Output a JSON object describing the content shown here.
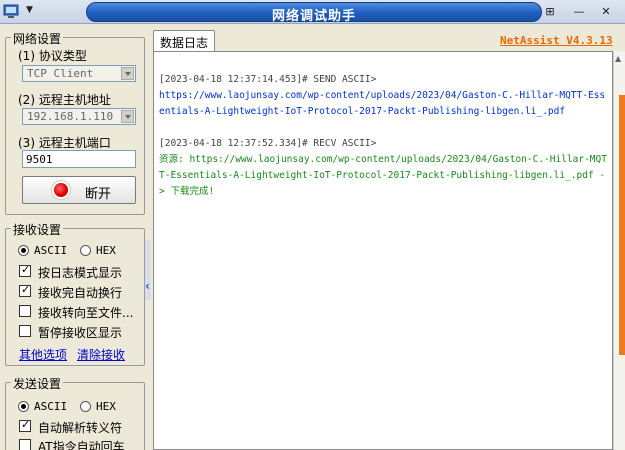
{
  "window": {
    "title": "网络调试助手",
    "controls": {
      "pin": "⊞",
      "minimize": "—",
      "close": "✕"
    }
  },
  "network": {
    "title": "网络设置",
    "protocol_label": "(1) 协议类型",
    "protocol_value": "TCP Client",
    "host_label": "(2) 远程主机地址",
    "host_value": "192.168.1.110",
    "port_label": "(3) 远程主机端口",
    "port_value": "9501",
    "open_button": "断开"
  },
  "receive": {
    "title": "接收设置",
    "ascii": "ASCII",
    "hex": "HEX",
    "options": [
      {
        "label": "按日志模式显示",
        "checked": true
      },
      {
        "label": "接收完自动换行",
        "checked": true
      },
      {
        "label": "接收转向至文件...",
        "checked": false
      },
      {
        "label": "暂停接收区显示",
        "checked": false
      }
    ],
    "more_link": "其他选项",
    "clear_link": "清除接收"
  },
  "send": {
    "title": "发送设置",
    "ascii": "ASCII",
    "hex": "HEX",
    "options": [
      {
        "label": "自动解析转义符",
        "checked": true
      },
      {
        "label": "AT指令自动回车",
        "checked": false
      }
    ]
  },
  "log": {
    "tab": "数据日志",
    "version": "NetAssist V4.3.13",
    "entries": [
      {
        "header": "[2023-04-18 12:37:14.453]# SEND ASCII>",
        "body": "https://www.laojunsay.com/wp-content/uploads/2023/04/Gaston-C.-Hillar-MQTT-Essentials-A-Lightweight-IoT-Protocol-2017-Packt-Publishing-libgen.li_.pdf"
      },
      {
        "header": "[2023-04-18 12:37:52.334]# RECV ASCII>",
        "body": "资源: https://www.laojunsay.com/wp-content/uploads/2023/04/Gaston-C.-Hillar-MQTT-Essentials-A-Lightweight-IoT-Protocol-2017-Packt-Publishing-libgen.li_.pdf -> 下载完成!"
      }
    ]
  }
}
